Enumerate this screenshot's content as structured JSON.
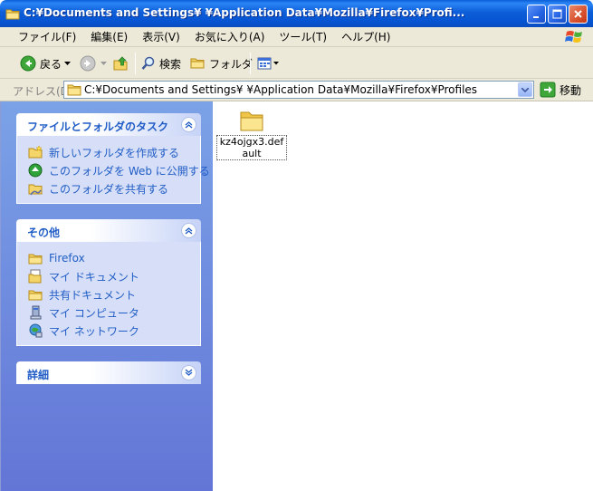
{
  "window": {
    "title": "C:¥Documents and Settings¥           ¥Application Data¥Mozilla¥Firefox¥Profi..."
  },
  "menu": {
    "items": [
      "ファイル(F)",
      "編集(E)",
      "表示(V)",
      "お気に入り(A)",
      "ツール(T)",
      "ヘルプ(H)"
    ]
  },
  "toolbar": {
    "back_label": "戻る",
    "search_label": "検索",
    "folders_label": "フォルダ"
  },
  "address": {
    "label": "アドレス(D)",
    "value": "C:¥Documents and Settings¥           ¥Application Data¥Mozilla¥Firefox¥Profiles",
    "go_label": "移動"
  },
  "tasks": {
    "file_folder": {
      "title": "ファイルとフォルダのタスク",
      "items": [
        "新しいフォルダを作成する",
        "このフォルダを Web に公開する",
        "このフォルダを共有する"
      ]
    },
    "other": {
      "title": "その他",
      "items": [
        "Firefox",
        "マイ ドキュメント",
        "共有ドキュメント",
        "マイ コンピュータ",
        "マイ ネットワーク"
      ]
    },
    "details": {
      "title": "詳細"
    }
  },
  "content": {
    "folder_name": "kz4ojgx3.default"
  }
}
